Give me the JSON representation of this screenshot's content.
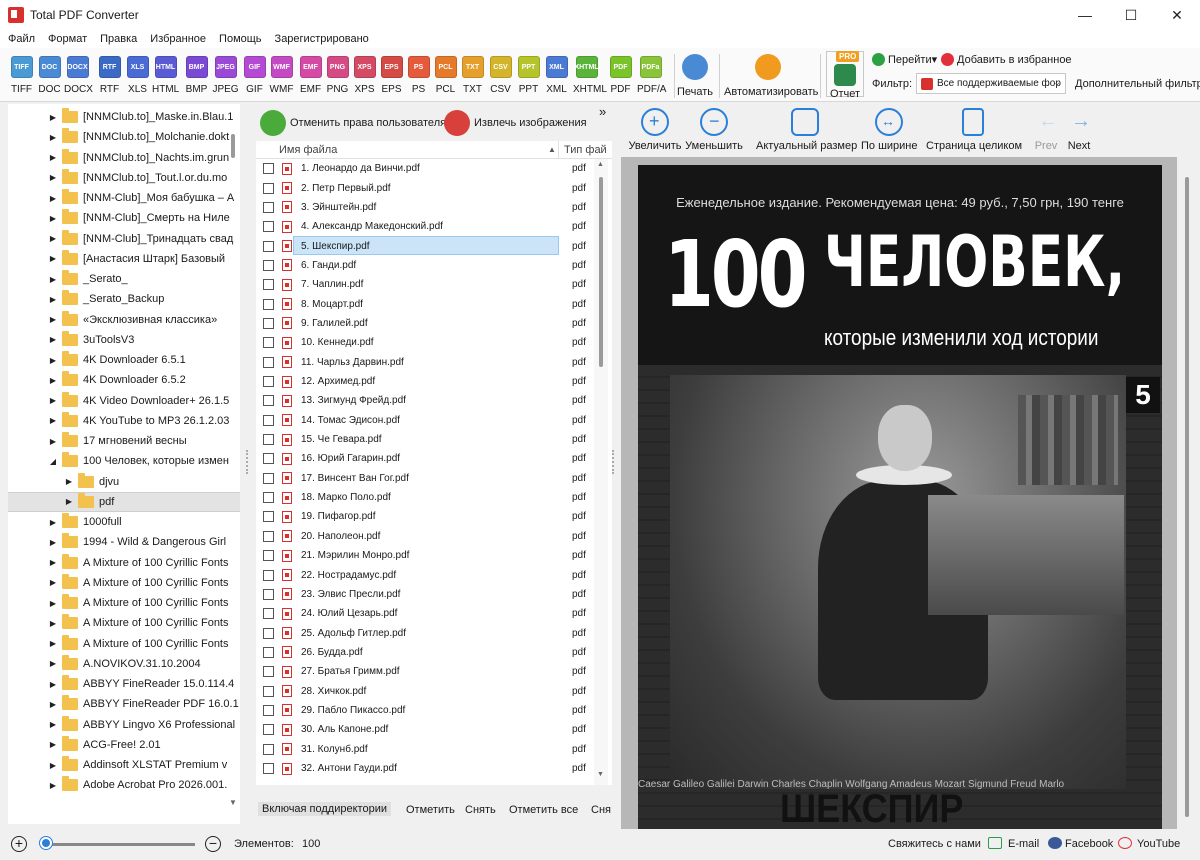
{
  "window": {
    "title": "Total PDF Converter",
    "minimize": "—",
    "maximize": "☐",
    "close": "✕"
  },
  "menu": [
    "Файл",
    "Формат",
    "Правка",
    "Избранное",
    "Помощь",
    "Зарегистрировано"
  ],
  "formats": [
    {
      "label": "TIFF",
      "icon": "TIFF",
      "color": "#4a9ad4"
    },
    {
      "label": "DOC",
      "icon": "DOC",
      "color": "#4a8ad4"
    },
    {
      "label": "DOCX",
      "icon": "DOCX",
      "color": "#4a7ad4"
    },
    {
      "label": "RTF",
      "icon": "RTF",
      "color": "#3a6ac4"
    },
    {
      "label": "XLS",
      "icon": "XLS",
      "color": "#4a6ad4"
    },
    {
      "label": "HTML",
      "icon": "HTML",
      "color": "#5a5ad4"
    },
    {
      "label": "BMP",
      "icon": "BMP",
      "color": "#7a4ad4"
    },
    {
      "label": "JPEG",
      "icon": "JPEG",
      "color": "#9a4ad4"
    },
    {
      "label": "GIF",
      "icon": "GIF",
      "color": "#b44ad4"
    },
    {
      "label": "WMF",
      "icon": "WMF",
      "color": "#c44ac4"
    },
    {
      "label": "EMF",
      "icon": "EMF",
      "color": "#d44aa4"
    },
    {
      "label": "PNG",
      "icon": "PNG",
      "color": "#d44a84"
    },
    {
      "label": "XPS",
      "icon": "XPS",
      "color": "#d44a64"
    },
    {
      "label": "EPS",
      "icon": "EPS",
      "color": "#d44a44"
    },
    {
      "label": "PS",
      "icon": "PS",
      "color": "#e45a3a"
    },
    {
      "label": "PCL",
      "icon": "PCL",
      "color": "#e47a2a"
    },
    {
      "label": "TXT",
      "icon": "TXT",
      "color": "#e4a02a"
    },
    {
      "label": "CSV",
      "icon": "CSV",
      "color": "#d4b42a"
    },
    {
      "label": "PPT",
      "icon": "PPT",
      "color": "#b4c42a"
    },
    {
      "label": "XML",
      "icon": "XML",
      "color": "#4a7ad4"
    },
    {
      "label": "XHTML",
      "icon": "XHTML",
      "color": "#5ab43a"
    },
    {
      "label": "PDF",
      "icon": "PDF",
      "color": "#7ac42a"
    },
    {
      "label": "PDF/A",
      "icon": "PDFa",
      "color": "#8ac43a"
    }
  ],
  "toolbar": {
    "print_label": "Печать",
    "automate_label": "Автоматизировать",
    "report_label": "Отчет",
    "pro_badge": "PRO",
    "goto_label": "Перейти▾",
    "favorite_label": "Добавить в избранное",
    "filter_label": "Фильтр:",
    "filter_value": "Все поддерживаемые фор",
    "advanced_filter": "Дополнительный фильтр"
  },
  "tree": [
    {
      "name": "[NNMClub.to]_Maske.in.Blau.1",
      "level": 0,
      "expanded": false,
      "selected": false
    },
    {
      "name": "[NNMClub.to]_Molchanie.dokt",
      "level": 0,
      "expanded": false,
      "selected": false
    },
    {
      "name": "[NNMClub.to]_Nachts.im.grun",
      "level": 0,
      "expanded": false,
      "selected": false
    },
    {
      "name": "[NNMClub.to]_Tout.l.or.du.mo",
      "level": 0,
      "expanded": false,
      "selected": false
    },
    {
      "name": "[NNM-Club]_Моя бабушка – А",
      "level": 0,
      "expanded": false,
      "selected": false
    },
    {
      "name": "[NNM-Club]_Смерть на Ниле",
      "level": 0,
      "expanded": false,
      "selected": false
    },
    {
      "name": "[NNM-Club]_Тринадцать свад",
      "level": 0,
      "expanded": false,
      "selected": false
    },
    {
      "name": "[Анастасия Штарк] Базовый",
      "level": 0,
      "expanded": false,
      "selected": false
    },
    {
      "name": "_Serato_",
      "level": 0,
      "expanded": false,
      "selected": false
    },
    {
      "name": "_Serato_Backup",
      "level": 0,
      "expanded": false,
      "selected": false
    },
    {
      "name": "«Эксклюзивная классика»",
      "level": 0,
      "expanded": false,
      "selected": false
    },
    {
      "name": "3uToolsV3",
      "level": 0,
      "expanded": false,
      "selected": false
    },
    {
      "name": "4K Downloader 6.5.1",
      "level": 0,
      "expanded": false,
      "selected": false
    },
    {
      "name": "4K Downloader 6.5.2",
      "level": 0,
      "expanded": false,
      "selected": false
    },
    {
      "name": "4K Video Downloader+ 26.1.5",
      "level": 0,
      "expanded": false,
      "selected": false
    },
    {
      "name": "4K YouTube to MP3 26.1.2.03",
      "level": 0,
      "expanded": false,
      "selected": false
    },
    {
      "name": "17 мгновений весны",
      "level": 0,
      "expanded": false,
      "selected": false
    },
    {
      "name": "100 Человек, которые измен",
      "level": 0,
      "expanded": true,
      "selected": false
    },
    {
      "name": "djvu",
      "level": 1,
      "expanded": false,
      "selected": false
    },
    {
      "name": "pdf",
      "level": 1,
      "expanded": false,
      "selected": true
    },
    {
      "name": "1000full",
      "level": 0,
      "expanded": false,
      "selected": false
    },
    {
      "name": "1994 - Wild & Dangerous Girl",
      "level": 0,
      "expanded": false,
      "selected": false
    },
    {
      "name": "A Mixture of 100 Cyrillic Fonts",
      "level": 0,
      "expanded": false,
      "selected": false
    },
    {
      "name": "A Mixture of 100 Cyrillic Fonts",
      "level": 0,
      "expanded": false,
      "selected": false
    },
    {
      "name": "A Mixture of 100 Cyrillic Fonts",
      "level": 0,
      "expanded": false,
      "selected": false
    },
    {
      "name": "A Mixture of 100 Cyrillic Fonts",
      "level": 0,
      "expanded": false,
      "selected": false
    },
    {
      "name": "A Mixture of 100 Cyrillic Fonts",
      "level": 0,
      "expanded": false,
      "selected": false
    },
    {
      "name": "A.NOVIKOV.31.10.2004",
      "level": 0,
      "expanded": false,
      "selected": false
    },
    {
      "name": "ABBYY FineReader 15.0.114.4",
      "level": 0,
      "expanded": false,
      "selected": false
    },
    {
      "name": "ABBYY FineReader PDF 16.0.1",
      "level": 0,
      "expanded": false,
      "selected": false
    },
    {
      "name": "ABBYY Lingvo X6 Professional",
      "level": 0,
      "expanded": false,
      "selected": false
    },
    {
      "name": "ACG-Free! 2.01",
      "level": 0,
      "expanded": false,
      "selected": false
    },
    {
      "name": "Addinsoft XLSTAT Premium v",
      "level": 0,
      "expanded": false,
      "selected": false
    },
    {
      "name": "Adobe Acrobat Pro 2026.001.",
      "level": 0,
      "expanded": false,
      "selected": false
    }
  ],
  "list_actions": {
    "unlock": "Отменить права пользователя",
    "extract": "Извлечь изображения",
    "more": "»"
  },
  "columns": {
    "name": "Имя файла",
    "type": "Тип фай",
    "sort_arrow": "▲"
  },
  "files": [
    {
      "name": "1. Леонардо да Винчи.pdf",
      "type": "pdf"
    },
    {
      "name": "2. Петр Первый.pdf",
      "type": "pdf"
    },
    {
      "name": "3. Эйнштейн.pdf",
      "type": "pdf"
    },
    {
      "name": "4. Александр Македонский.pdf",
      "type": "pdf"
    },
    {
      "name": "5. Шекспир.pdf",
      "type": "pdf",
      "selected": true
    },
    {
      "name": "6. Ганди.pdf",
      "type": "pdf"
    },
    {
      "name": "7. Чаплин.pdf",
      "type": "pdf"
    },
    {
      "name": "8. Моцарт.pdf",
      "type": "pdf"
    },
    {
      "name": "9. Галилей.pdf",
      "type": "pdf"
    },
    {
      "name": "10. Кеннеди.pdf",
      "type": "pdf"
    },
    {
      "name": "11. Чарльз Дарвин.pdf",
      "type": "pdf"
    },
    {
      "name": "12. Архимед.pdf",
      "type": "pdf"
    },
    {
      "name": "13. Зигмунд Фрейд.pdf",
      "type": "pdf"
    },
    {
      "name": "14. Томас Эдисон.pdf",
      "type": "pdf"
    },
    {
      "name": "15. Че Гевара.pdf",
      "type": "pdf"
    },
    {
      "name": "16. Юрий Гагарин.pdf",
      "type": "pdf"
    },
    {
      "name": "17. Винсент Ван Гог.pdf",
      "type": "pdf"
    },
    {
      "name": "18. Марко Поло.pdf",
      "type": "pdf"
    },
    {
      "name": "19. Пифагор.pdf",
      "type": "pdf"
    },
    {
      "name": "20. Наполеон.pdf",
      "type": "pdf"
    },
    {
      "name": "21. Мэрилин Монро.pdf",
      "type": "pdf"
    },
    {
      "name": "22. Нострадамус.pdf",
      "type": "pdf"
    },
    {
      "name": "23. Элвис Пресли.pdf",
      "type": "pdf"
    },
    {
      "name": "24. Юлий Цезарь.pdf",
      "type": "pdf"
    },
    {
      "name": "25. Адольф Гитлер.pdf",
      "type": "pdf"
    },
    {
      "name": "26. Будда.pdf",
      "type": "pdf"
    },
    {
      "name": "27. Братья Гримм.pdf",
      "type": "pdf"
    },
    {
      "name": "28. Хичкок.pdf",
      "type": "pdf"
    },
    {
      "name": "29. Пабло Пикассо.pdf",
      "type": "pdf"
    },
    {
      "name": "30. Аль Капоне.pdf",
      "type": "pdf"
    },
    {
      "name": "31. Колунб.pdf",
      "type": "pdf"
    },
    {
      "name": "32. Антони Гауди.pdf",
      "type": "pdf"
    }
  ],
  "list_bottom": {
    "include_subdirs": "Включая поддиректории",
    "mark": "Отметить",
    "unmark": "Снять",
    "mark_all": "Отметить все",
    "cut": "Сня"
  },
  "preview_toolbar": {
    "zoom_in": "Увеличить",
    "zoom_out": "Уменьшить",
    "actual_size": "Актуальный размер",
    "fit_width": "По ширине",
    "whole_page": "Страница целиком",
    "prev": "Prev",
    "next": "Next"
  },
  "cover": {
    "top_line": "Еженедельное издание. Рекомендуемая цена: 49 руб., 7,50 грн, 190 тенге",
    "big_number": "100",
    "headline": "ЧЕЛОВЕК,",
    "subtitle": "которые изменили ход истории",
    "issue": "5",
    "names_strip": "Caesar Galileo Galilei Darwin Charles Chaplin Wolfgang Amadeus Mozart Sigmund Freud Marlo",
    "bottom_title": "ШЕКСПИР"
  },
  "status": {
    "zoom_plus": "+",
    "zoom_minus": "−",
    "zoom_level": 0.02,
    "elements_label": "Элементов:",
    "elements_value": "100",
    "contact": "Свяжитесь с нами",
    "email": "E-mail",
    "facebook": "Facebook",
    "youtube": "YouTube"
  }
}
